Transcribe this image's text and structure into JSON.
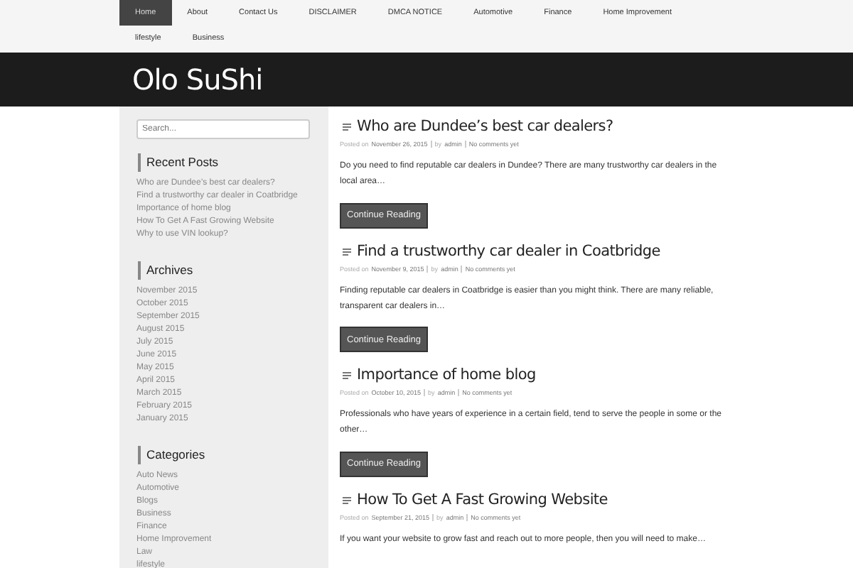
{
  "nav": [
    {
      "label": "Home",
      "selected": true
    },
    {
      "label": "About",
      "selected": false
    },
    {
      "label": "Contact Us",
      "selected": false
    },
    {
      "label": "DISCLAIMER",
      "selected": false
    },
    {
      "label": "DMCA NOTICE",
      "selected": false
    },
    {
      "label": "Automotive",
      "selected": false
    },
    {
      "label": "Finance",
      "selected": false
    },
    {
      "label": "Home Improvement",
      "selected": false
    },
    {
      "label": "lifestyle",
      "selected": false
    },
    {
      "label": "Business",
      "selected": false
    }
  ],
  "site_title": "Olo SuShi",
  "sidebar": {
    "search": {
      "placeholder": "Search..."
    },
    "widgets": [
      {
        "title": "Recent Posts",
        "items": [
          "Who are Dundee’s best car dealers?",
          "Find a trustworthy car dealer in Coatbridge",
          "Importance of home blog",
          "How To Get A Fast Growing Website",
          "Why to use VIN lookup?"
        ]
      },
      {
        "title": "Archives",
        "items": [
          "November 2015",
          "October 2015",
          "September 2015",
          "August 2015",
          "July 2015",
          "June 2015",
          "May 2015",
          "April 2015",
          "March 2015",
          "February 2015",
          "January 2015"
        ]
      },
      {
        "title": "Categories",
        "items": [
          "Auto News",
          "Automotive",
          "Blogs",
          "Business",
          "Finance",
          "Home Improvement",
          "Law",
          "lifestyle"
        ]
      }
    ]
  },
  "posts": [
    {
      "title": "Who are Dundee’s best car dealers?",
      "posted_label": "Posted on",
      "date": "November 26, 2015",
      "by_label": "by",
      "author": "admin",
      "comments": "No comments yet",
      "excerpt": "Do you need to find  reputable car dealers in Dundee? There are many trustworthy car dealers in the local area…",
      "button": "Continue Reading"
    },
    {
      "title": "Find a trustworthy car dealer in Coatbridge",
      "posted_label": "Posted on",
      "date": "November 9, 2015",
      "by_label": "by",
      "author": "admin",
      "comments": "No comments yet",
      "excerpt": "Finding reputable car dealers in Coatbridge  is easier than you might think. There are many reliable, transparent car dealers in…",
      "button": "Continue Reading"
    },
    {
      "title": "Importance of home blog",
      "posted_label": "Posted on",
      "date": "October 10, 2015",
      "by_label": "by",
      "author": "admin",
      "comments": "No comments yet",
      "excerpt": "Professionals who have years of experience in a certain field, tend to serve the people in some or the other…",
      "button": "Continue Reading"
    },
    {
      "title": "How To Get A Fast Growing Website",
      "posted_label": "Posted on",
      "date": "September 21, 2015",
      "by_label": "by",
      "author": "admin",
      "comments": "No comments yet",
      "excerpt": "If you want your website to grow fast and reach out to more people, then you will need to make…"
    }
  ]
}
